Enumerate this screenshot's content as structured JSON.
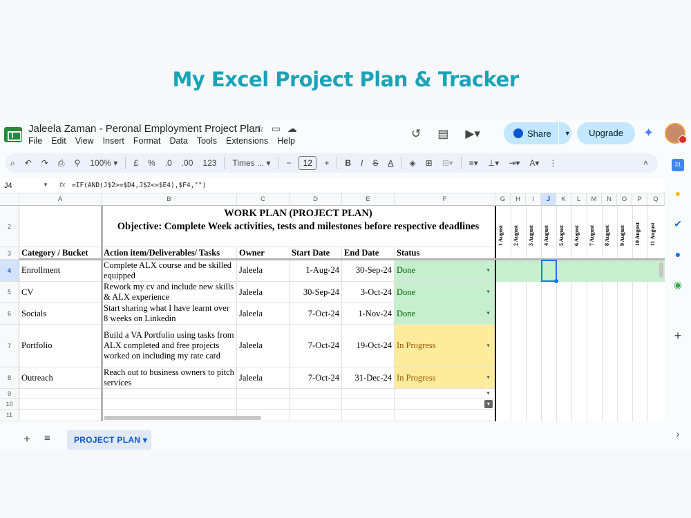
{
  "banner": "My Excel Project Plan & Tracker",
  "app": {
    "doc_title": "Jaleela Zaman - Peronal Employment Project Plan",
    "menu": [
      "File",
      "Edit",
      "View",
      "Insert",
      "Format",
      "Data",
      "Tools",
      "Extensions",
      "Help"
    ],
    "share_label": "Share",
    "upgrade_label": "Upgrade"
  },
  "toolbar": {
    "zoom": "100%",
    "currency": "£",
    "percent": "%",
    "dec_dec": ".0",
    "dec_inc": ".00",
    "number_format": "123",
    "font": "Times ...",
    "font_size": "12"
  },
  "formula_bar": {
    "cell_ref": "J4",
    "formula": "=IF(AND(J$2>=$D4,J$2<=$E4),$F4,\"\")"
  },
  "columns": [
    "A",
    "B",
    "C",
    "D",
    "E",
    "F",
    "G",
    "H",
    "I",
    "J",
    "K",
    "L",
    "M",
    "N",
    "O",
    "P",
    "Q"
  ],
  "rows": [
    "2",
    "3",
    "4",
    "5",
    "6",
    "7",
    "8",
    "9",
    "10",
    "11"
  ],
  "sheet": {
    "title": "WORK PLAN (PROJECT PLAN)",
    "objective": "Objective: Complete Week  activities, tests and milestones before respective deadlines",
    "headers": [
      "Category / Bucket",
      "Action item/Deliverables/ Tasks",
      "Owner",
      "Start Date",
      "End Date",
      "Status"
    ],
    "date_headers": [
      "1 August",
      "2 August",
      "3 August",
      "4 August",
      "5 August",
      "6 August",
      "7 August",
      "8 August",
      "9 August",
      "10 August",
      "11 August"
    ],
    "tasks": [
      {
        "category": "Enrollment",
        "task": "Complete ALX course and be skilled equipped",
        "owner": "Jaleela",
        "start": "1-Aug-24",
        "end": "30-Sep-24",
        "status": "Done"
      },
      {
        "category": "CV",
        "task": "Rework my cv and include new skills  & ALX experience",
        "owner": "Jaleela",
        "start": "30-Sep-24",
        "end": "3-Oct-24",
        "status": "Done"
      },
      {
        "category": "Socials",
        "task": "Start sharing what I have learnt over 8 weeks on Linkedin",
        "owner": "Jaleela",
        "start": "7-Oct-24",
        "end": "1-Nov-24",
        "status": "Done"
      },
      {
        "category": "Portfolio",
        "task": "Build a VA Portfolio using tasks from ALX completed and free projects worked on including my rate card",
        "owner": "Jaleela",
        "start": "7-Oct-24",
        "end": "19-Oct-24",
        "status": "In Progress"
      },
      {
        "category": "Outreach",
        "task": "Reach out to business owners to pitch services",
        "owner": "Jaleela",
        "start": "7-Oct-24",
        "end": "31-Dec-24",
        "status": "In Progress"
      }
    ]
  },
  "tabs": {
    "active": "PROJECT PLAN"
  },
  "colors": {
    "brand": "#1ba3b8",
    "done_bg": "#c6efce",
    "progress_bg": "#ffeb9c",
    "selection": "#1a73e8"
  }
}
